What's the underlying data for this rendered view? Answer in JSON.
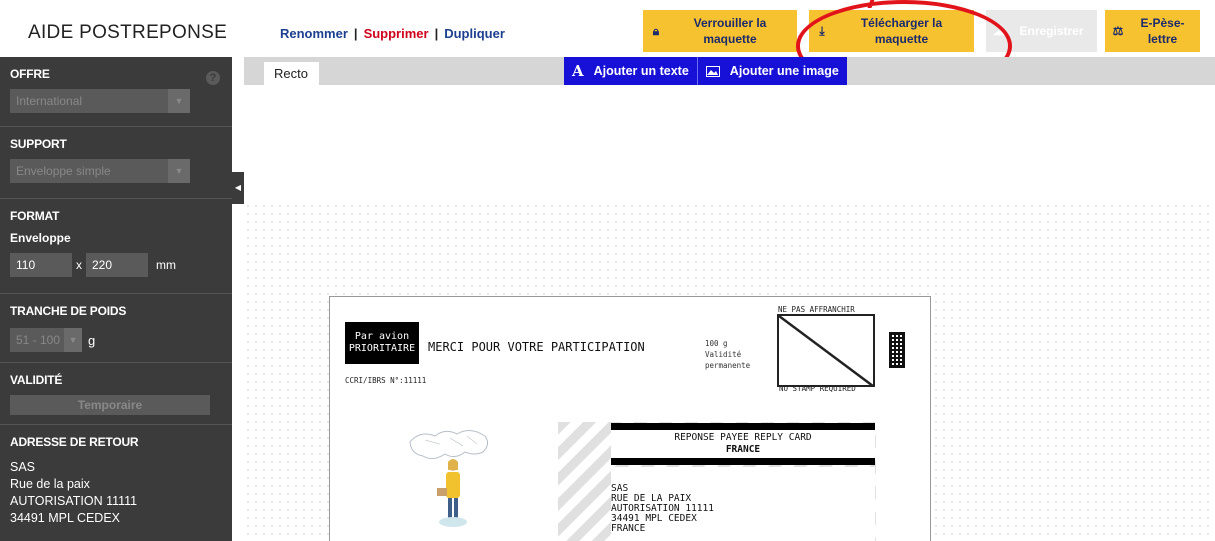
{
  "header": {
    "title": "AIDE POSTREPONSE",
    "actions": {
      "rename": "Renommer",
      "delete": "Supprimer",
      "duplicate": "Dupliquer",
      "separator": "|"
    },
    "buttons": {
      "lock": {
        "label": "Verrouiller la maquette",
        "icon": "lock-icon"
      },
      "download": {
        "label": "Télécharger la maquette",
        "icon": "download-icon"
      },
      "save": {
        "label": "Enregistrer",
        "icon": "cloud-icon",
        "state": "disabled"
      },
      "epese": {
        "label": "E-Pèse-lettre",
        "icon": "scale-icon"
      }
    }
  },
  "sidebar": {
    "offre": {
      "title": "OFFRE",
      "help": "?",
      "value": "International"
    },
    "support": {
      "title": "SUPPORT",
      "value": "Enveloppe simple"
    },
    "format": {
      "title": "FORMAT",
      "subtitle": "Enveloppe",
      "width": "110",
      "times": "x",
      "height": "220",
      "unit": "mm"
    },
    "weight": {
      "title": "TRANCHE DE POIDS",
      "value": "51 - 100",
      "unit": "g"
    },
    "validity": {
      "title": "VALIDITÉ",
      "value": "Temporaire"
    },
    "return_address": {
      "title": "ADRESSE DE RETOUR",
      "lines": [
        "SAS",
        "Rue de la paix",
        "AUTORISATION 11111",
        "34491 MPL CEDEX"
      ]
    }
  },
  "editor": {
    "tab": "Recto",
    "tools": {
      "add_text": "Ajouter un texte",
      "add_text_icon": "A",
      "add_image": "Ajouter une image"
    }
  },
  "card": {
    "airmail": [
      "Par avion",
      "PRIORITAIRE"
    ],
    "message": "MERCI POUR VOTRE PARTICIPATION",
    "ccri": "CCRI/IBRS N°:11111",
    "info": [
      "100 g",
      "Validité",
      "permanente"
    ],
    "no_stamp_top": "NE PAS AFFRANCHIR",
    "no_stamp_bottom": "NO STAMP REQUIRED",
    "reply_title": "REPONSE PAYEE REPLY CARD",
    "reply_country": "FRANCE",
    "address": [
      "SAS",
      "RUE DE LA PAIX",
      "AUTORISATION 11111",
      "34491 MPL CEDEX",
      "FRANCE"
    ]
  },
  "colors": {
    "accent_yellow": "#f7c230",
    "nav_blue": "#1d3f8f",
    "delete_red": "#d0021b",
    "tool_blue": "#1710d6",
    "sidebar_bg": "#3b3b3b",
    "annotation_red": "#e2141b"
  }
}
